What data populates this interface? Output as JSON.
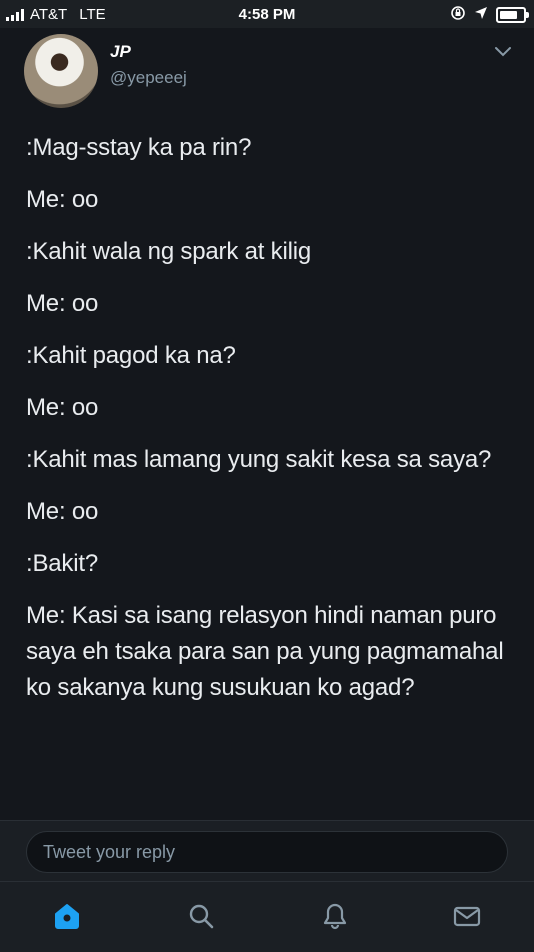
{
  "status_bar": {
    "carrier": "AT&T",
    "network": "LTE",
    "time": "4:58 PM"
  },
  "tweet": {
    "display_name": "JP",
    "handle": "@yepeeej",
    "lines": [
      ":Mag-sstay ka pa rin?",
      "Me: oo",
      ":Kahit wala ng spark at kilig",
      "Me: oo",
      ":Kahit pagod ka na?",
      "Me: oo",
      ":Kahit mas lamang yung sakit kesa sa saya?",
      "Me: oo",
      ":Bakit?",
      "Me: Kasi sa isang relasyon hindi naman puro saya eh tsaka para san pa yung pagmamahal ko sakanya kung susukuan ko agad?"
    ]
  },
  "reply": {
    "placeholder": "Tweet your reply"
  },
  "tab_bar": {
    "tabs": [
      {
        "icon": "home-icon",
        "active": true
      },
      {
        "icon": "search-icon",
        "active": false
      },
      {
        "icon": "notifications-icon",
        "active": false
      },
      {
        "icon": "messages-icon",
        "active": false
      }
    ]
  },
  "colors": {
    "background": "#14171c",
    "accent": "#1da1f2",
    "text": "#e9ecef",
    "muted": "#8899a6"
  }
}
